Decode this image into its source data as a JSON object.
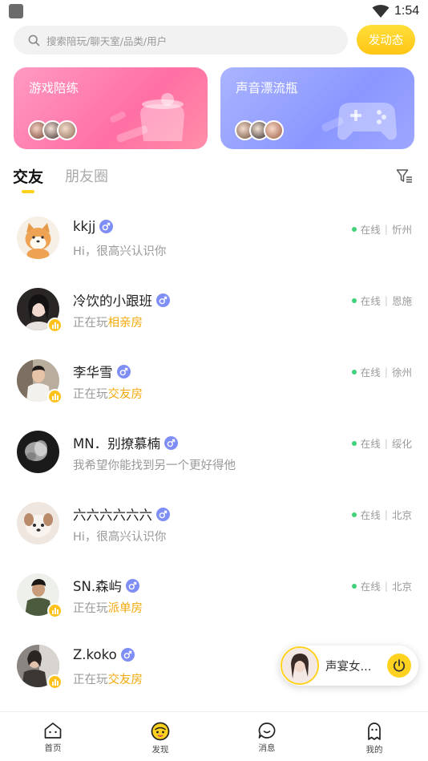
{
  "status_bar": {
    "time": "1:54"
  },
  "search": {
    "placeholder": "搜索陪玩/聊天室/品类/用户",
    "post_label": "发动态"
  },
  "banners": [
    {
      "title": "游戏陪练",
      "color": "#ff78ac"
    },
    {
      "title": "声音漂流瓶",
      "color": "#8f9aff"
    }
  ],
  "tabs": [
    {
      "label": "交友",
      "active": true
    },
    {
      "label": "朋友圈",
      "active": false
    }
  ],
  "users": [
    {
      "name": "kkjj",
      "status": "Hi，很高兴认识你",
      "room": "",
      "online": "在线",
      "city": "忻州",
      "live": false
    },
    {
      "name": "冷饮的小跟班",
      "status": "正在玩",
      "room": "相亲房",
      "online": "在线",
      "city": "恩施",
      "live": true
    },
    {
      "name": "李华雪",
      "status": "正在玩",
      "room": "交友房",
      "online": "在线",
      "city": "徐州",
      "live": true
    },
    {
      "name": "MN．别撩慕楠",
      "status": "我希望你能找到另一个更好得他",
      "room": "",
      "online": "在线",
      "city": "绥化",
      "live": false
    },
    {
      "name": "六六六六六六",
      "status": "Hi，很高兴认识你",
      "room": "",
      "online": "在线",
      "city": "北京",
      "live": false
    },
    {
      "name": "SN.森屿",
      "status": "正在玩",
      "room": "派单房",
      "online": "在线",
      "city": "北京",
      "live": true
    },
    {
      "name": "Z.koko",
      "status": "正在玩",
      "room": "交友房",
      "online": "",
      "city": "",
      "live": true
    }
  ],
  "mini_player": {
    "name": "声宴女..."
  },
  "nav": [
    {
      "label": "首页",
      "icon": "home-icon"
    },
    {
      "label": "发现",
      "icon": "discover-icon"
    },
    {
      "label": "消息",
      "icon": "message-icon"
    },
    {
      "label": "我的",
      "icon": "profile-icon"
    }
  ],
  "colors": {
    "accent": "#ffd21f",
    "online": "#3ed37a",
    "room": "#f2a90b",
    "male": "#7f8ef5"
  }
}
